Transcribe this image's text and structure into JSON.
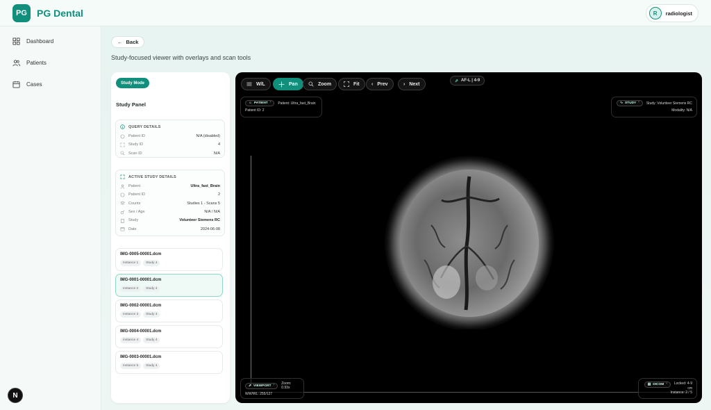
{
  "header": {
    "logo_badge": "PG",
    "app_name": "PG Dental",
    "user_initial": "R",
    "user_name": "radiologist"
  },
  "sidebar": {
    "items": [
      {
        "label": "Dashboard",
        "icon": "dashboard-grid-icon"
      },
      {
        "label": "Patients",
        "icon": "users-icon"
      },
      {
        "label": "Cases",
        "icon": "calendar-icon"
      }
    ],
    "footer_badge": "N"
  },
  "main": {
    "back_label": "Back",
    "subtitle": "Study-focused viewer with overlays and scan tools"
  },
  "panel": {
    "mode_label": "Study Mode",
    "title": "Study Panel",
    "query": {
      "heading": "QUERY DETAILS",
      "rows": [
        {
          "label": "Patient ID",
          "value": "N/A (disabled)"
        },
        {
          "label": "Study ID",
          "value": "4"
        },
        {
          "label": "Scan ID",
          "value": "N/A"
        }
      ]
    },
    "active": {
      "heading": "ACTIVE STUDY DETAILS",
      "rows": [
        {
          "label": "Patient",
          "value": "Ultra_fast_Brain"
        },
        {
          "label": "Patient ID",
          "value": "2"
        },
        {
          "label": "Counts",
          "value": "Studies 1 - Scans 5"
        },
        {
          "label": "Sex / Age",
          "value": "N/A / N/A"
        },
        {
          "label": "Study",
          "value": "Volunteer Siemens RC"
        },
        {
          "label": "Date",
          "value": "2024-06-08"
        }
      ]
    },
    "files": [
      {
        "name": "IMG-0005-00001.dcm",
        "instance": "Instance 1",
        "study": "Study 4"
      },
      {
        "name": "IMG-0001-00001.dcm",
        "instance": "Instance 2",
        "study": "Study 4"
      },
      {
        "name": "IMG-0002-00001.dcm",
        "instance": "Instance 3",
        "study": "Study 4"
      },
      {
        "name": "IMG-0004-00001.dcm",
        "instance": "Instance 4",
        "study": "Study 4"
      },
      {
        "name": "IMG-0003-00001.dcm",
        "instance": "Instance 5",
        "study": "Study 4"
      }
    ],
    "active_file_index": 1
  },
  "viewer": {
    "toolbar": {
      "wl": "W/L",
      "pan": "Pan",
      "zoom": "Zoom",
      "fit": "Fit",
      "prev": "Prev",
      "next": "Next"
    },
    "active_tool": "Pan",
    "frame_label": "AF-L | 4-9",
    "patient_overlay": {
      "tag": "PATIENT",
      "patient": "Patient: Ultra_fast_Brain",
      "patient_id": "Patient ID: 2"
    },
    "study_overlay": {
      "tag": "STUDY",
      "study": "Study: Volunteer Siemens RC",
      "modality": "Modality: N/A"
    },
    "viewport_overlay": {
      "tag": "VIEWPORT",
      "zoom": "Zoom: 0.93x",
      "wwwl": "WW/WL: 255/127"
    },
    "dicom_overlay": {
      "tag": "DICOM",
      "locked": "Locked: 4-9",
      "unit": "cm",
      "instance": "Instance: 2 / 5"
    }
  },
  "colors": {
    "brand": "#0f8f7c",
    "viewer_bg": "#000000"
  }
}
